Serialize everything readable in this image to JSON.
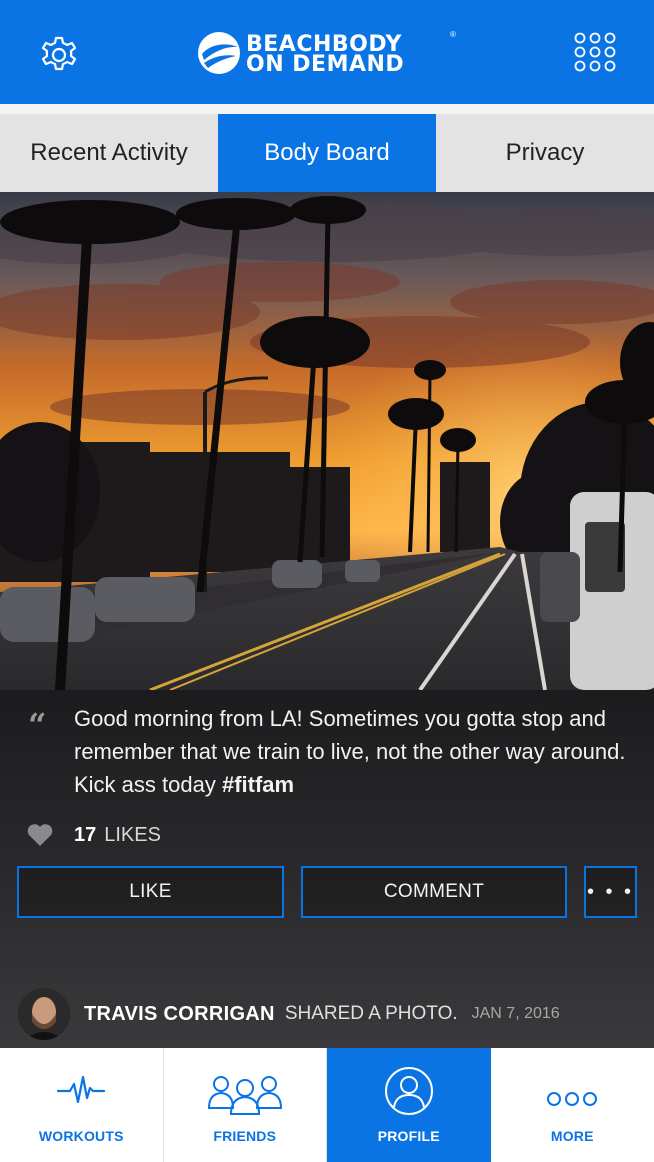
{
  "header": {
    "settings_icon": "gear-icon",
    "apps_icon": "grid-icon",
    "logo_line1": "BEACHBODY",
    "logo_line2": "ON DEMAND",
    "logo_reg": "®"
  },
  "tabs": [
    {
      "label": "Recent Activity",
      "active": false
    },
    {
      "label": "Body Board",
      "active": true
    },
    {
      "label": "Privacy",
      "active": false
    }
  ],
  "post": {
    "caption_text": "Good morning from LA! Sometimes you gotta stop and remember that we train to live, not the other way around. Kick ass today ",
    "caption_tag": "#fitfam",
    "quote_mark": "“",
    "likes_count": "17",
    "likes_label": "LIKES",
    "like_button": "LIKE",
    "comment_button": "COMMENT",
    "more_button": "• • •",
    "author_name": "TRAVIS CORRIGAN",
    "shared_text": "SHARED A PHOTO.",
    "date": "JAN 7, 2016"
  },
  "nav": [
    {
      "label": "WORKOUTS",
      "icon": "pulse-icon",
      "active": false
    },
    {
      "label": "FRIENDS",
      "icon": "friends-icon",
      "active": false
    },
    {
      "label": "PROFILE",
      "icon": "profile-icon",
      "active": true
    },
    {
      "label": "MORE",
      "icon": "more-dots-icon",
      "active": false
    }
  ],
  "colors": {
    "brand_blue": "#0b74e5",
    "tab_bg": "#e3e3e4",
    "post_bg": "#1c1b1d"
  }
}
